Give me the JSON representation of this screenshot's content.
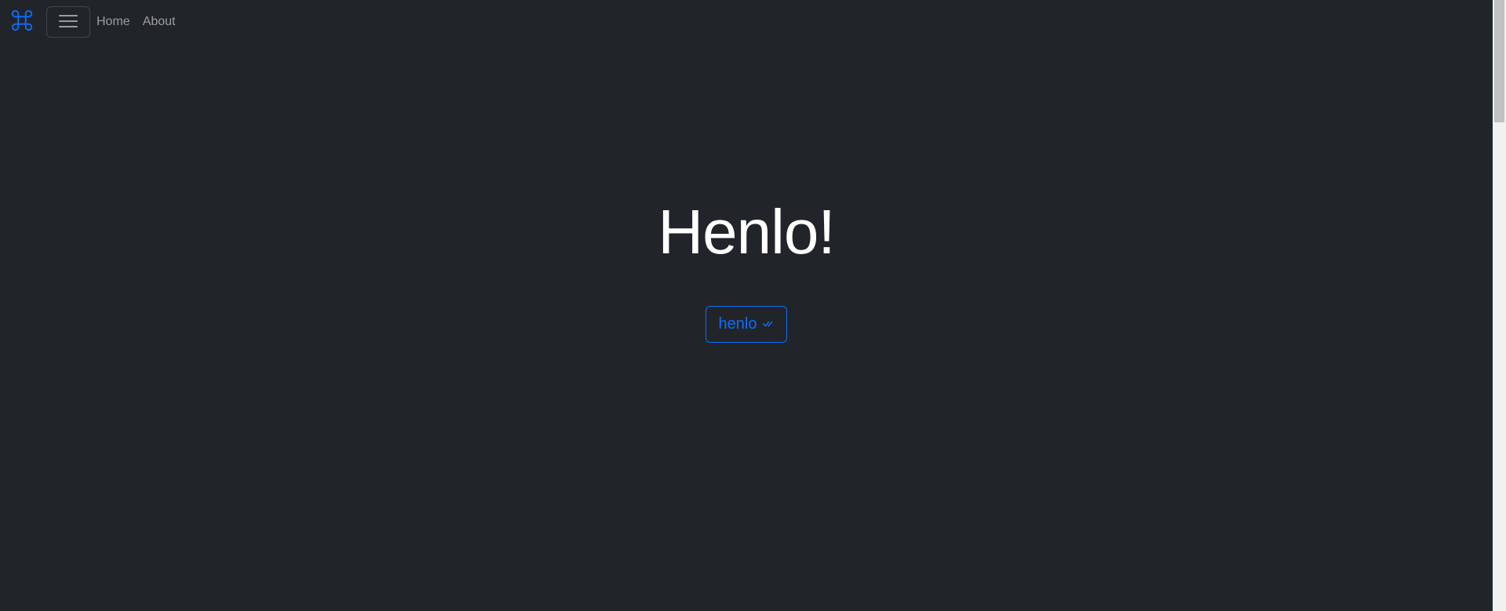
{
  "navbar": {
    "brand_icon": "command-icon",
    "toggler_icon": "hamburger-menu-icon",
    "links": [
      {
        "label": "Home"
      },
      {
        "label": "About"
      }
    ]
  },
  "hero": {
    "title": "Henlo!",
    "button_label": "henlo",
    "button_icon": "check-all-icon"
  },
  "colors": {
    "background": "#212529",
    "accent": "#0d6efd",
    "title": "#ffffff",
    "nav_link": "#8e9093"
  }
}
